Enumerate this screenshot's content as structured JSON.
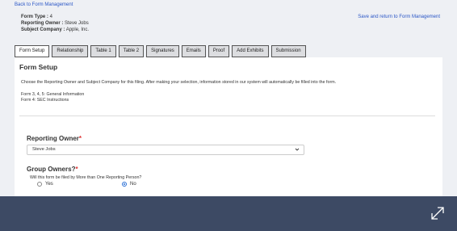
{
  "nav": {
    "back_label": "Back to Form Management",
    "save_label": "Save and return to Form Management"
  },
  "meta": {
    "form_type_key": "Form Type :",
    "form_type_val": "4",
    "owner_key": "Reporting Owner :",
    "owner_val": "Steve Jobs",
    "company_key": "Subject Company :",
    "company_val": "Apple, Inc."
  },
  "tabs": [
    {
      "label": "Form Setup",
      "active": true
    },
    {
      "label": "Relationship"
    },
    {
      "label": "Table 1"
    },
    {
      "label": "Table 2"
    },
    {
      "label": "Signatures"
    },
    {
      "label": "Emails"
    },
    {
      "label": "Proof"
    },
    {
      "label": "Add Exhibits"
    },
    {
      "label": "Submission"
    }
  ],
  "panel": {
    "title": "Form Setup",
    "intro": "Choose the Reporting Owner and Subject Company for this filing. After making your selection, information stored in our system will automatically be filled into the form.",
    "line1": "Form 3, 4, 5: General Information",
    "line2": "Form 4: SEC Instructions"
  },
  "reporting_owner": {
    "label": "Reporting Owner",
    "required": "*",
    "value": "Steve Jobs"
  },
  "group_owners": {
    "label": "Group Owners?",
    "required": "*",
    "question": "Will this form be filed by More than One Reporting Person?",
    "yes_label": "Yes",
    "no_label": "No",
    "selected": "No"
  },
  "icons": {
    "select_chevron": "chevron-down-icon",
    "expand": "expand-icon"
  },
  "colors": {
    "link": "#2a56c6",
    "overlay": "#3d4a64",
    "required": "#d33333"
  }
}
